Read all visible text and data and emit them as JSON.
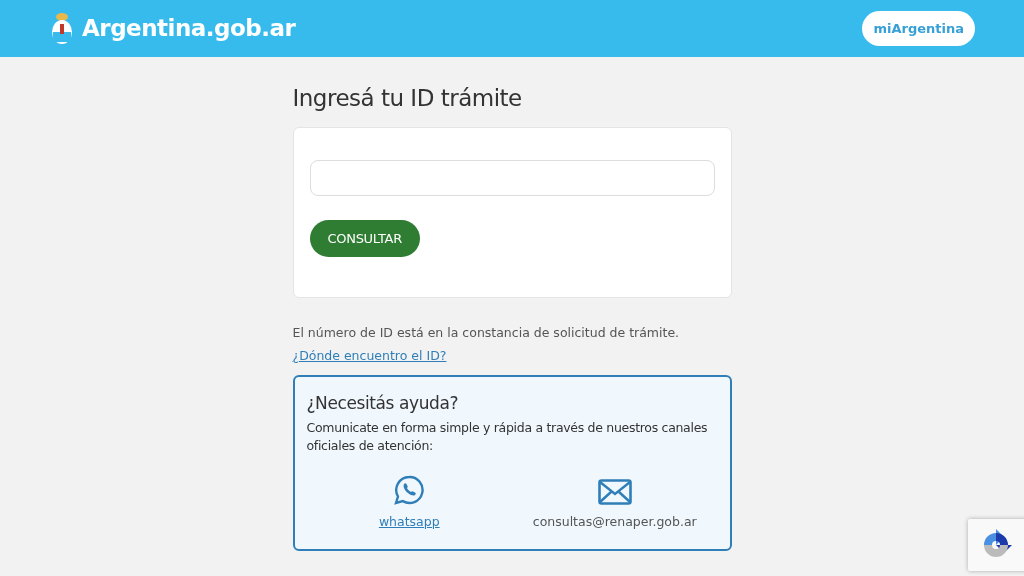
{
  "header": {
    "brand": "Argentina.gob.ar",
    "account_button": "miArgentina"
  },
  "title": "Ingresá tu ID trámite",
  "form": {
    "submit_button": "CONSULTAR"
  },
  "hint": "El número de ID está en la constancia de solicitud de trámite.",
  "hint_link": "¿Dónde encuentro el ID?",
  "help": {
    "title": "¿Necesitás ayuda?",
    "text": "Comunicate en forma simple y rápida a través de nuestros canales oficiales de atención:",
    "channels": [
      {
        "kind": "whatsapp",
        "label": "whatsapp",
        "link": true
      },
      {
        "kind": "email",
        "label": "consultas@renaper.gob.ar",
        "link": false
      }
    ]
  }
}
